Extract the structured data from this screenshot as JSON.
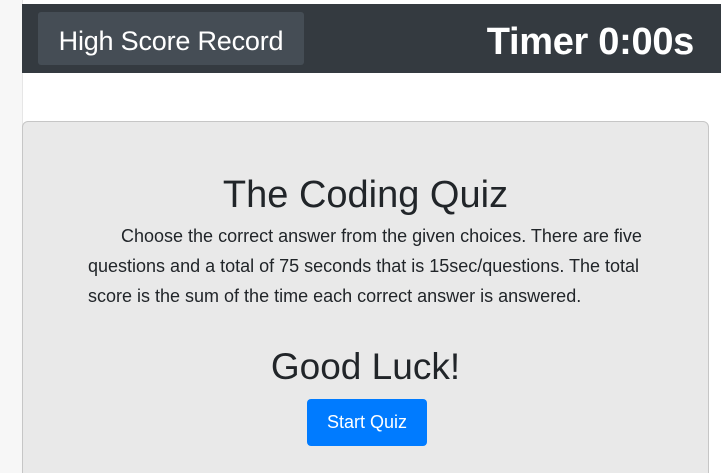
{
  "navbar": {
    "high_score_label": "High Score Record",
    "timer_label": "Timer",
    "timer_value": "0:00s"
  },
  "quiz": {
    "title": "The Coding Quiz",
    "instructions": "Choose the correct answer from the given choices. There are five questions and a total of 75 seconds that is 15sec/questions. The total score is the sum of the time each correct answer is answered.",
    "good_luck": "Good Luck!",
    "start_label": "Start Quiz"
  },
  "colors": {
    "navbar_bg": "#343a40",
    "button_dark": "#454d55",
    "primary": "#007bff",
    "card_bg": "#e9e9e9"
  }
}
